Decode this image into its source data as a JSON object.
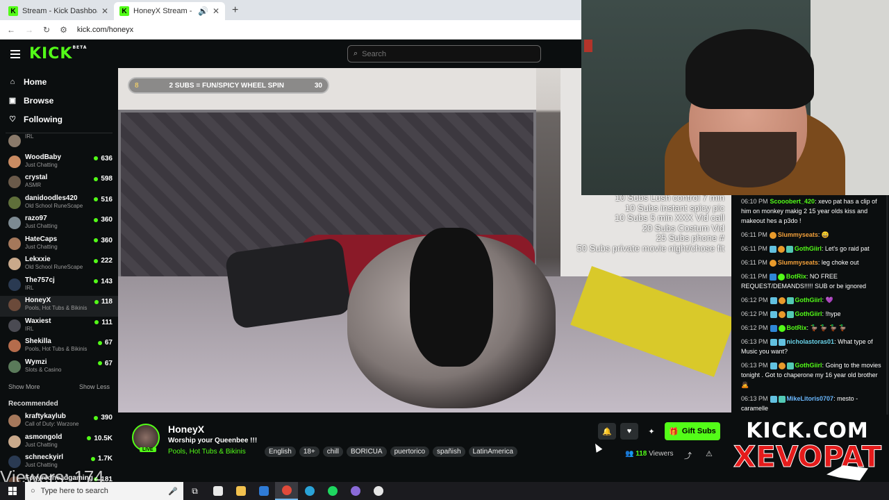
{
  "browser": {
    "tabs": [
      {
        "label": "Stream - Kick Dashboard",
        "active": false
      },
      {
        "label": "HoneyX Stream - Watch Live",
        "active": true
      }
    ],
    "url": "kick.com/honeyx"
  },
  "header": {
    "logo": "KICK",
    "logo_badge": "BETA",
    "search_placeholder": "Search"
  },
  "sidebar": {
    "nav": [
      {
        "label": "Home",
        "icon": "home-icon"
      },
      {
        "label": "Browse",
        "icon": "browse-icon"
      },
      {
        "label": "Following",
        "icon": "heart-icon"
      }
    ],
    "following": [
      {
        "name": "",
        "category": "IRL",
        "viewers": ""
      },
      {
        "name": "WoodBaby",
        "category": "Just Chatting",
        "viewers": "636"
      },
      {
        "name": "crystal",
        "category": "ASMR",
        "viewers": "598"
      },
      {
        "name": "danidoodles420",
        "category": "Old School RuneScape",
        "viewers": "516"
      },
      {
        "name": "razo97",
        "category": "Just Chatting",
        "viewers": "360"
      },
      {
        "name": "HateCaps",
        "category": "Just Chatting",
        "viewers": "360"
      },
      {
        "name": "Lekxxie",
        "category": "Old School RuneScape",
        "viewers": "222"
      },
      {
        "name": "The757cj",
        "category": "IRL",
        "viewers": "143"
      },
      {
        "name": "HoneyX",
        "category": "Pools, Hot Tubs & Bikinis",
        "viewers": "118"
      },
      {
        "name": "Waxiest",
        "category": "IRL",
        "viewers": "111"
      },
      {
        "name": "Shekilla",
        "category": "Pools, Hot Tubs & Bikinis",
        "viewers": "67"
      },
      {
        "name": "Wymzi",
        "category": "Slots & Casino",
        "viewers": "67"
      }
    ],
    "show_more": "Show More",
    "show_less": "Show Less",
    "recommended_title": "Recommended",
    "recommended": [
      {
        "name": "kraftykaylub",
        "category": "Call of Duty: Warzone",
        "viewers": "390"
      },
      {
        "name": "asmongold",
        "category": "Just Chatting",
        "viewers": "10.5K"
      },
      {
        "name": "schneckyirl",
        "category": "Just Chatting",
        "viewers": "1.7K"
      },
      {
        "name": "Foxyredheadgaming",
        "category": "",
        "viewers": "181"
      }
    ]
  },
  "video": {
    "goal": {
      "left": "8",
      "label": "2 SUBS = FUN/SPICY WHEEL SPIN",
      "right": "30"
    },
    "menu_lines": [
      "10 Subs Lush control 7 min",
      "10 Subs instant spicy pic",
      "10 Subs 5 min XXX Vid call",
      "20 Subs Costum Vid",
      "25 Subs phone #",
      "50 Subs private movie night/chose fit"
    ]
  },
  "stream": {
    "live_label": "LIVE",
    "name": "HoneyX",
    "title": "Worship your Queenbee !!!",
    "category": "Pools, Hot Tubs & Bikinis",
    "tags": [
      "English",
      "18+",
      "chill",
      "BORICUA",
      "puertorico",
      "spañish",
      "LatinAmerica"
    ],
    "gift_label": "Gift Subs",
    "viewers": "118",
    "viewers_label": "Viewers"
  },
  "chat": [
    {
      "time": "06:10 PM",
      "badges": [],
      "user": "Scooobert_420",
      "color": "#53fc18",
      "text": "xevo pat has a clip of him on monkey makig 2 15 year olds kiss and makeout hes a p3do !"
    },
    {
      "time": "06:11 PM",
      "badges": [
        "star"
      ],
      "user": "Slummyseats",
      "color": "#f2a03a",
      "text": "😄"
    },
    {
      "time": "06:11 PM",
      "badges": [
        "sub",
        "star",
        "gift"
      ],
      "user": "GothGiirl",
      "color": "#53fc18",
      "text": "Let's go raid pat"
    },
    {
      "time": "06:11 PM",
      "badges": [
        "star"
      ],
      "user": "Slummyseats",
      "color": "#f2a03a",
      "text": "leg choke out"
    },
    {
      "time": "06:11 PM",
      "badges": [
        "bot",
        "ok"
      ],
      "user": "BotRix",
      "color": "#53fc18",
      "text": "NO FREE REQUEST/DEMANDS!!!!! SUB or be ignored"
    },
    {
      "time": "06:12 PM",
      "badges": [
        "sub",
        "star",
        "gift"
      ],
      "user": "GothGiirl",
      "color": "#53fc18",
      "text": "💜"
    },
    {
      "time": "06:12 PM",
      "badges": [
        "sub",
        "star",
        "gift"
      ],
      "user": "GothGiirl",
      "color": "#53fc18",
      "text": "!hype"
    },
    {
      "time": "06:12 PM",
      "badges": [
        "bot",
        "ok"
      ],
      "user": "BotRix",
      "color": "#53fc18",
      "text": "🦆 🦆 🦆 🦆"
    },
    {
      "time": "06:13 PM",
      "badges": [
        "sub",
        "pick"
      ],
      "user": "nicholastoras01",
      "color": "#6ad3e9",
      "text": "What type of Music you want?"
    },
    {
      "time": "06:13 PM",
      "badges": [
        "sub",
        "star",
        "gift"
      ],
      "user": "GothGiirl",
      "color": "#53fc18",
      "text": "Going to the movies tonight . Got to chaperone my 16 year old brother 🙇"
    },
    {
      "time": "06:13 PM",
      "badges": [
        "sub",
        "gift"
      ],
      "user": "MikeLitoris0707",
      "color": "#6ab8ff",
      "text": "mesto - caramelle"
    }
  ],
  "overlay": {
    "brand_top": "KICK.COM",
    "brand_bottom": "XEVOPAT",
    "viewer_counter": "Viewers: 174"
  },
  "taskbar": {
    "search_placeholder": "Type here to search"
  },
  "colors": {
    "accent": "#53fc18",
    "background": "#0b0e0f",
    "brand_red": "#e41b1b"
  }
}
